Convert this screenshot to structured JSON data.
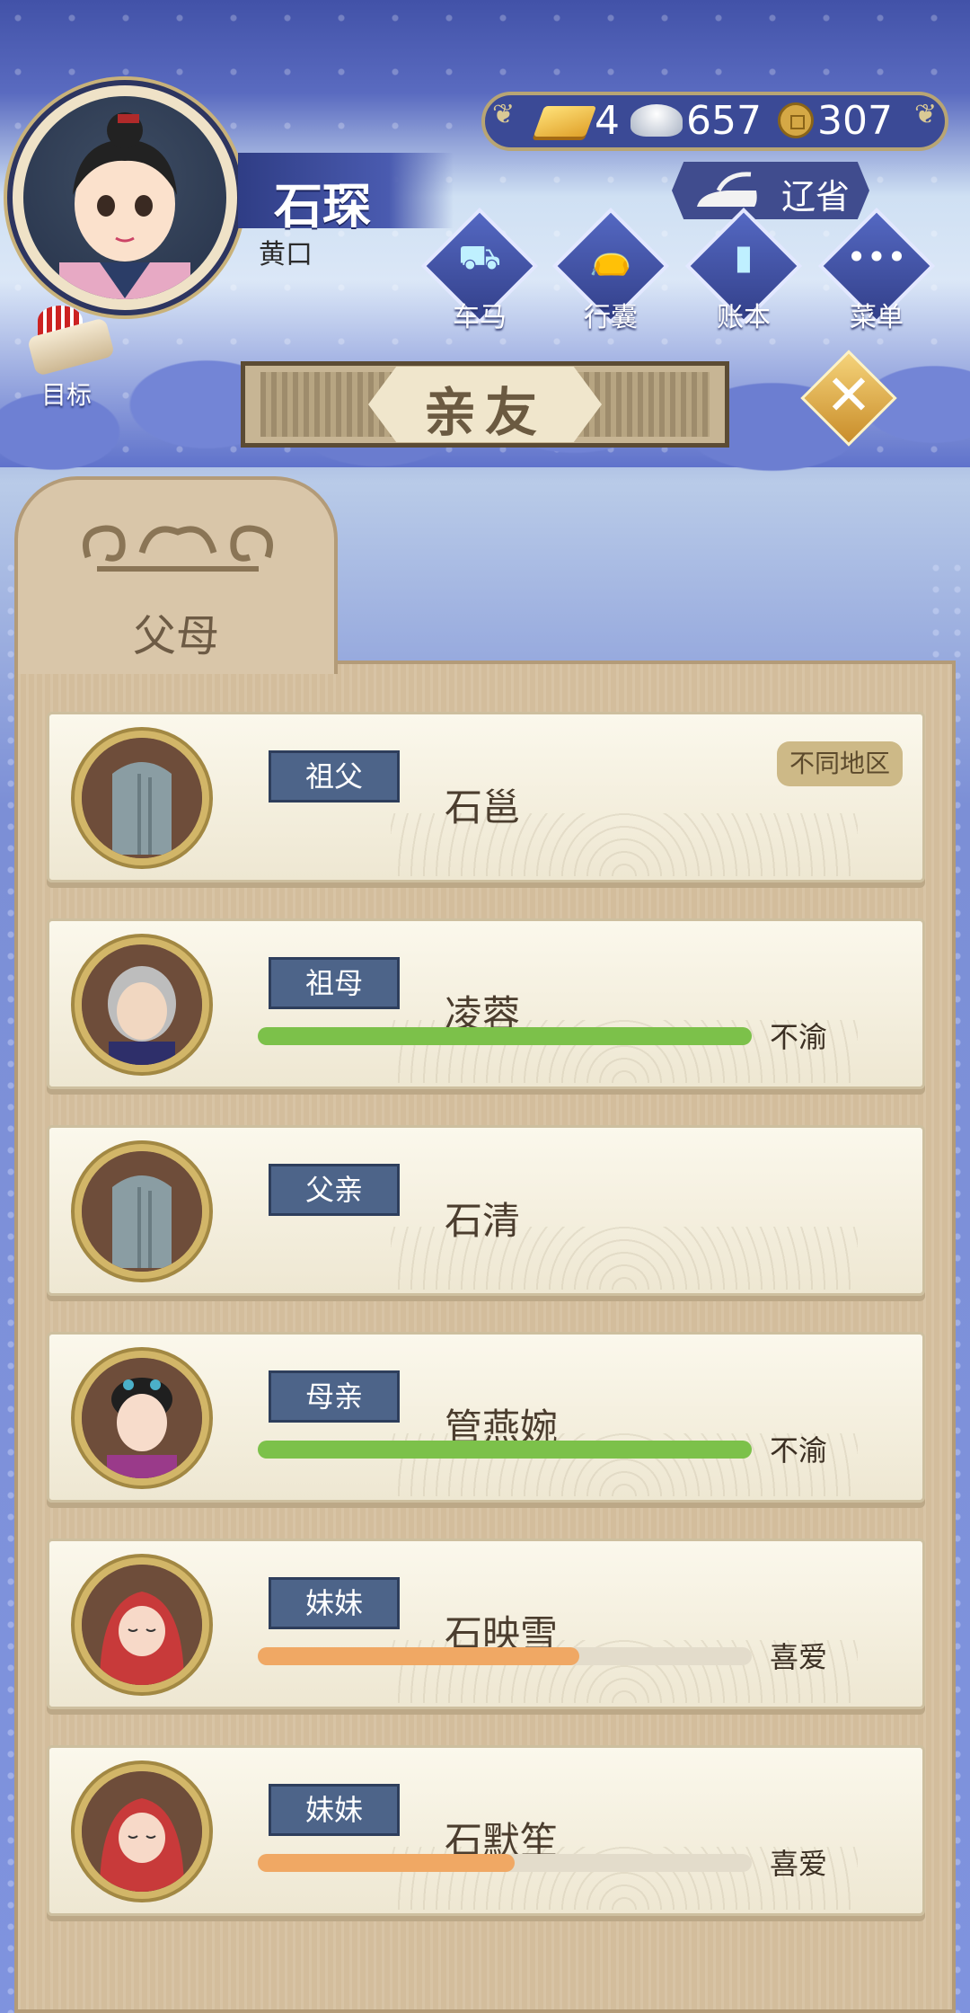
{
  "player": {
    "name": "石琛",
    "rank": "黄口"
  },
  "resources": {
    "gold": "4",
    "silver": "657",
    "coins": "307"
  },
  "province_button": {
    "label": "辽省"
  },
  "menu": [
    {
      "label": "车马",
      "icon": "carriage-icon"
    },
    {
      "label": "行囊",
      "icon": "bag-icon"
    },
    {
      "label": "账本",
      "icon": "ledger-icon"
    },
    {
      "label": "菜单",
      "icon": "more-icon"
    }
  ],
  "goal_button": {
    "label": "目标"
  },
  "title": "亲友",
  "tab": {
    "label": "父母"
  },
  "members": [
    {
      "role": "祖父",
      "name": "石邕",
      "status_tag": "不同地区",
      "deceased": true
    },
    {
      "role": "祖母",
      "name": "凌蓉",
      "mood": "不渝",
      "affection": 1.0,
      "bar_color": "#7cc14a"
    },
    {
      "role": "父亲",
      "name": "石清",
      "deceased": true
    },
    {
      "role": "母亲",
      "name": "管燕婉",
      "mood": "不渝",
      "affection": 1.0,
      "bar_color": "#7cc14a"
    },
    {
      "role": "妹妹",
      "name": "石映雪",
      "mood": "喜爱",
      "affection": 0.65,
      "bar_color": "#f0a864"
    },
    {
      "role": "妹妹",
      "name": "石默笙",
      "mood": "喜爱",
      "affection": 0.52,
      "bar_color": "#f0a864"
    }
  ],
  "colors": {
    "accent": "#4d6489",
    "panel": "#d8c4a5",
    "header": "#3b4a96"
  }
}
